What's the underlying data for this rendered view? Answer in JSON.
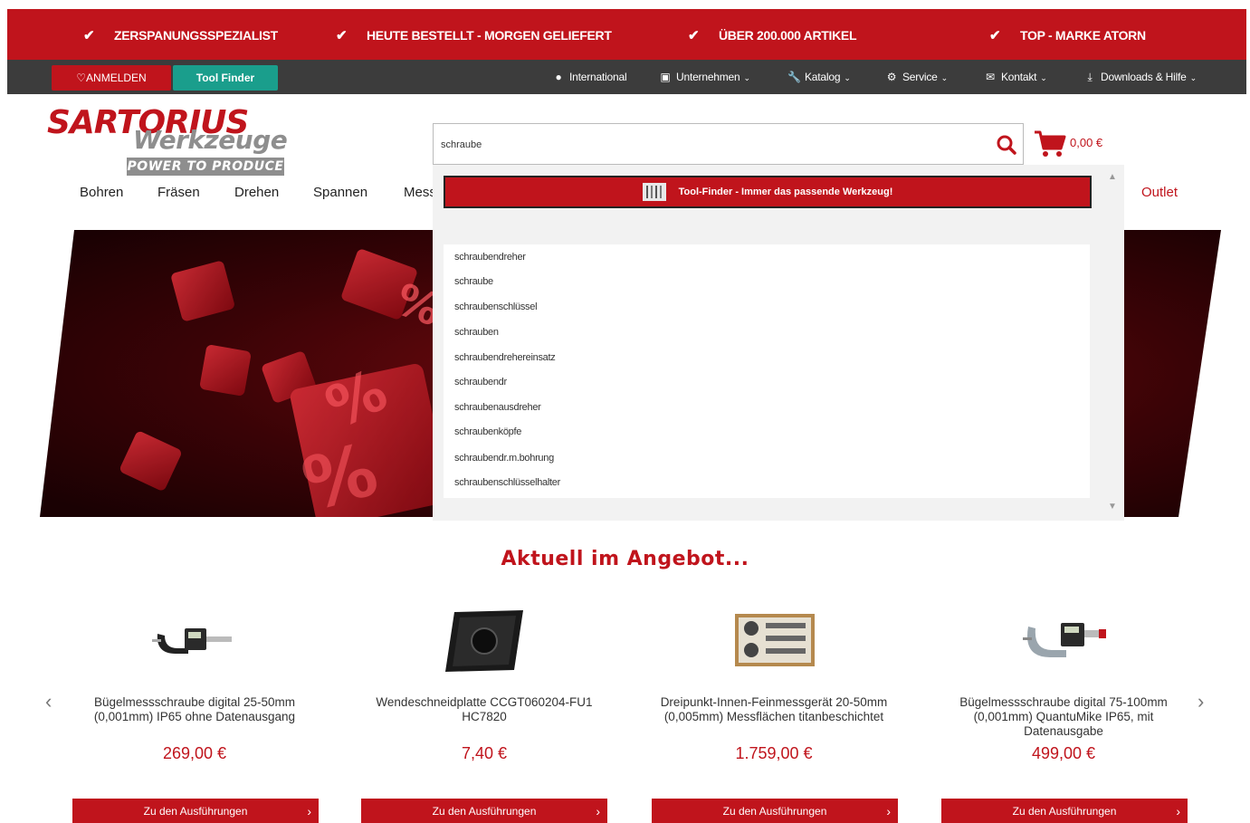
{
  "usps": [
    {
      "label": "ZERSPANUNGSSPEZIALIST"
    },
    {
      "label": "HEUTE BESTELLT - MORGEN GELIEFERT"
    },
    {
      "label": "ÜBER 200.000 ARTIKEL"
    },
    {
      "label": "TOP - MARKE ATORN"
    }
  ],
  "nav": {
    "login_label": "ANMELDEN",
    "toolfinder_label": "Tool Finder",
    "links": [
      {
        "label": "International",
        "icon": "globe-icon"
      },
      {
        "label": "Unternehmen",
        "icon": "building-icon"
      },
      {
        "label": "Katalog",
        "icon": "wrench-icon"
      },
      {
        "label": "Service",
        "icon": "service-icon"
      },
      {
        "label": "Kontakt",
        "icon": "envelope-icon"
      },
      {
        "label": "Downloads & Hilfe",
        "icon": "download-icon"
      }
    ]
  },
  "logo": {
    "main": "SARTORIUS",
    "sub": "Werkzeuge",
    "tagline": "POWER TO PRODUCE"
  },
  "search": {
    "value": "schraube",
    "placeholder": ""
  },
  "cart": {
    "total": "0,00 €"
  },
  "categories": [
    {
      "label": "Bohren"
    },
    {
      "label": "Fräsen"
    },
    {
      "label": "Drehen"
    },
    {
      "label": "Spannen"
    },
    {
      "label": "Mess"
    },
    {
      "label": "Outlet"
    }
  ],
  "dropdown": {
    "toolfinder_banner": "Tool-Finder - Immer das passende Werkzeug!",
    "suggestions": [
      "schraubendreher",
      "schraube",
      "schraubenschlüssel",
      "schrauben",
      "schraubendrehereinsatz",
      "schraubendr",
      "schraubenausdreher",
      "schraubenköpfe",
      "schraubendr.m.bohrung",
      "schraubenschlüsselhalter"
    ]
  },
  "offers": {
    "title": "Aktuell im Angebot...",
    "button_label": "Zu den Ausführungen",
    "products": [
      {
        "name": "Bügelmessschraube digital 25-50mm (0,001mm) IP65 ohne Datenausgang",
        "price": "269,00 €"
      },
      {
        "name": "Wendeschneidplatte CCGT060204-FU1 HC7820",
        "price": "7,40 €"
      },
      {
        "name": "Dreipunkt-Innen-Feinmessgerät 20-50mm (0,005mm) Messflächen titanbeschichtet",
        "price": "1.759,00 €"
      },
      {
        "name": "Bügelmessschraube digital 75-100mm (0,001mm) QuantuMike IP65, mit Datenausgabe",
        "price": "499,00 €"
      }
    ]
  },
  "colors": {
    "brand_red": "#c0141c",
    "dark_bar": "#3c3c3c",
    "teal": "#1a9e8c",
    "logo_grey": "#8e8e8e"
  }
}
